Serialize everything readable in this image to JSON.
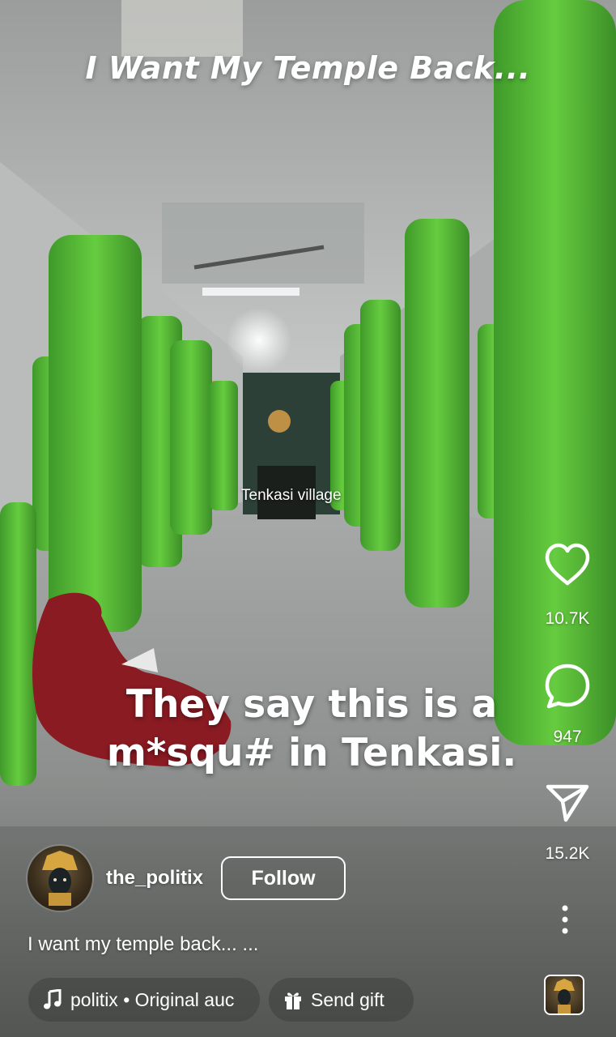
{
  "overlay": {
    "title": "I Want My Temple Back...",
    "location_tag": "Tenkasi village",
    "caption_line1": "They say this is a",
    "caption_line2": "m*squ# in Tenkasi."
  },
  "actions": {
    "likes": "10.7K",
    "comments": "947",
    "shares": "15.2K"
  },
  "user": {
    "username": "the_politix",
    "follow_label": "Follow"
  },
  "post": {
    "description": "I want my temple back... ..."
  },
  "audio": {
    "label": "politix • Original auc"
  },
  "gift": {
    "label": "Send gift"
  },
  "icons": [
    "heart-icon",
    "comment-icon",
    "share-icon",
    "more-icon",
    "music-note-icon",
    "gift-icon"
  ],
  "colors": {
    "pillar_green": "#5fc23a",
    "overlay_text": "#ffffff"
  }
}
